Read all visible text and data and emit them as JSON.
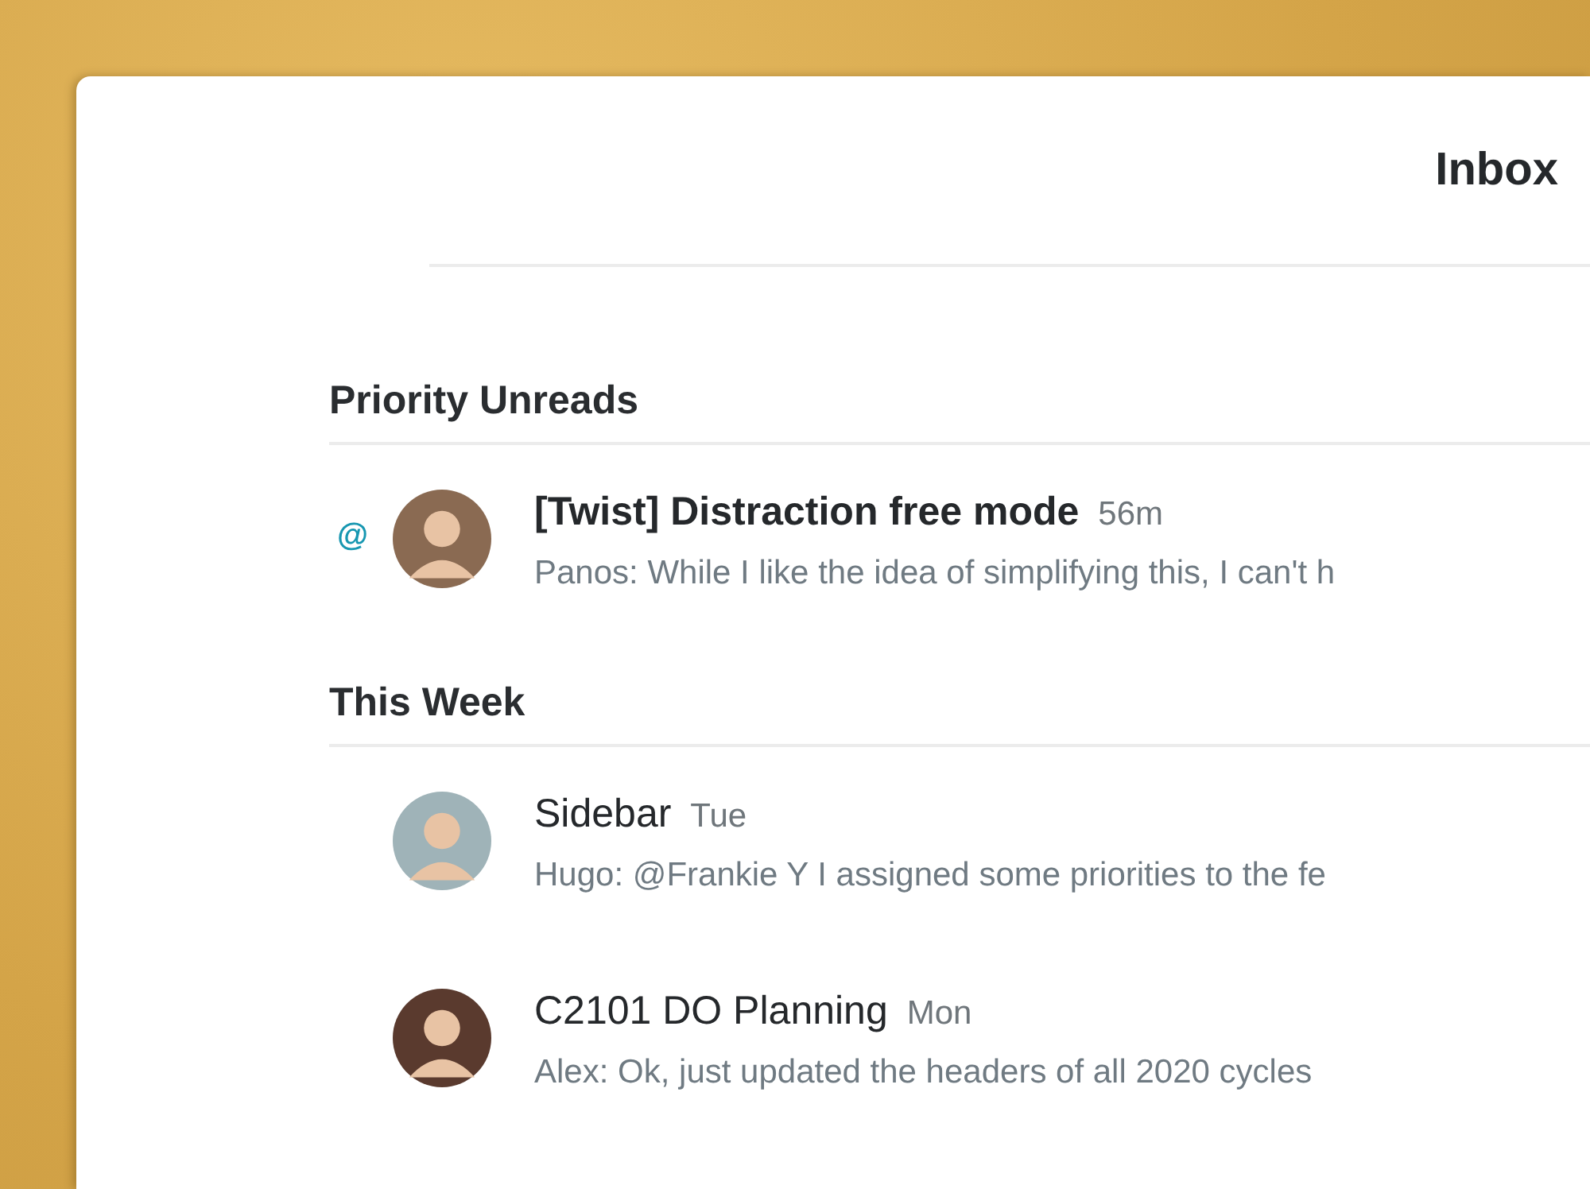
{
  "header": {
    "title": "Inbox"
  },
  "sections": [
    {
      "title": "Priority Unreads",
      "threads": [
        {
          "mention": "@",
          "unread": true,
          "title": "[Twist] Distraction free mode",
          "time": "56m",
          "preview": "Panos: While I like the idea of simplifying this, I can't h"
        }
      ]
    },
    {
      "title": "This Week",
      "threads": [
        {
          "unread": false,
          "title": "Sidebar",
          "time": "Tue",
          "preview": "Hugo: @Frankie Y I assigned some priorities to the fe"
        },
        {
          "unread": false,
          "title": "C2101 DO Planning",
          "time": "Mon",
          "preview": "Alex: Ok, just updated the headers of all 2020 cycles"
        }
      ]
    }
  ]
}
